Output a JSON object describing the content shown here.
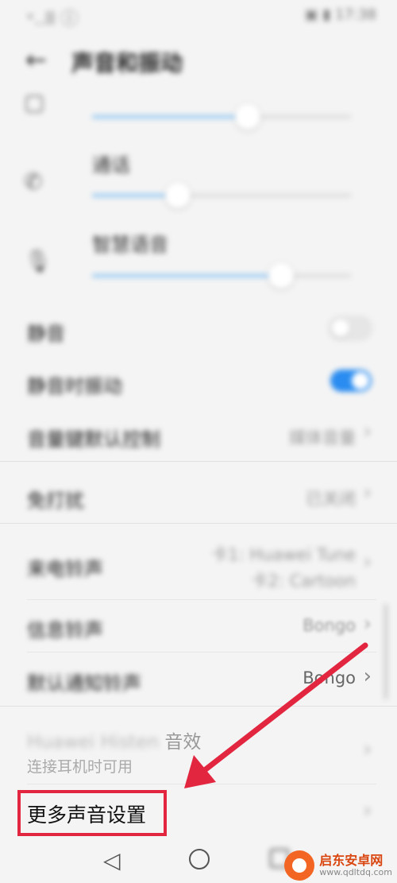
{
  "status_bar": {
    "left": "ᵛ..ll ⓘ",
    "right": "▣ ▮ 17:38"
  },
  "header": {
    "back_icon": "←",
    "title": "声音和振动"
  },
  "volumes": [
    {
      "icon": "calendar-icon",
      "glyph": "▢",
      "label": "",
      "level": 0.6
    },
    {
      "icon": "phone-icon",
      "glyph": "✆",
      "label": "通话",
      "level": 0.33
    },
    {
      "icon": "mic-icon",
      "glyph": "🎙",
      "label": "智慧语音",
      "level": 0.73
    }
  ],
  "settings": [
    {
      "label": "静音",
      "toggle": false
    },
    {
      "label": "静音时振动",
      "toggle": true
    },
    {
      "label": "音量键默认控制",
      "value": "媒体音量"
    },
    {
      "label": "免打扰",
      "value": "已关闭"
    },
    {
      "label": "来电铃声",
      "value_line1": "卡1: Huawei Tune",
      "value_line2": "卡2: Cartoon"
    },
    {
      "label": "信息铃声",
      "value": "Bongo"
    },
    {
      "label": "默认通知铃声",
      "value": "Bongo"
    }
  ],
  "histen": {
    "label_en": "Huawei Histen",
    "label_cn": "音效",
    "sublabel": "连接耳机时可用"
  },
  "more_settings": {
    "label": "更多声音设置"
  },
  "chevron": "›",
  "nav": {
    "back": "◁"
  },
  "watermark": {
    "name": "启东安卓网",
    "url": "www.qdltdq.com"
  },
  "colors": {
    "accent": "#2a8cf0",
    "highlight": "#e3263f",
    "slider_fill": "#8fc6f3"
  }
}
